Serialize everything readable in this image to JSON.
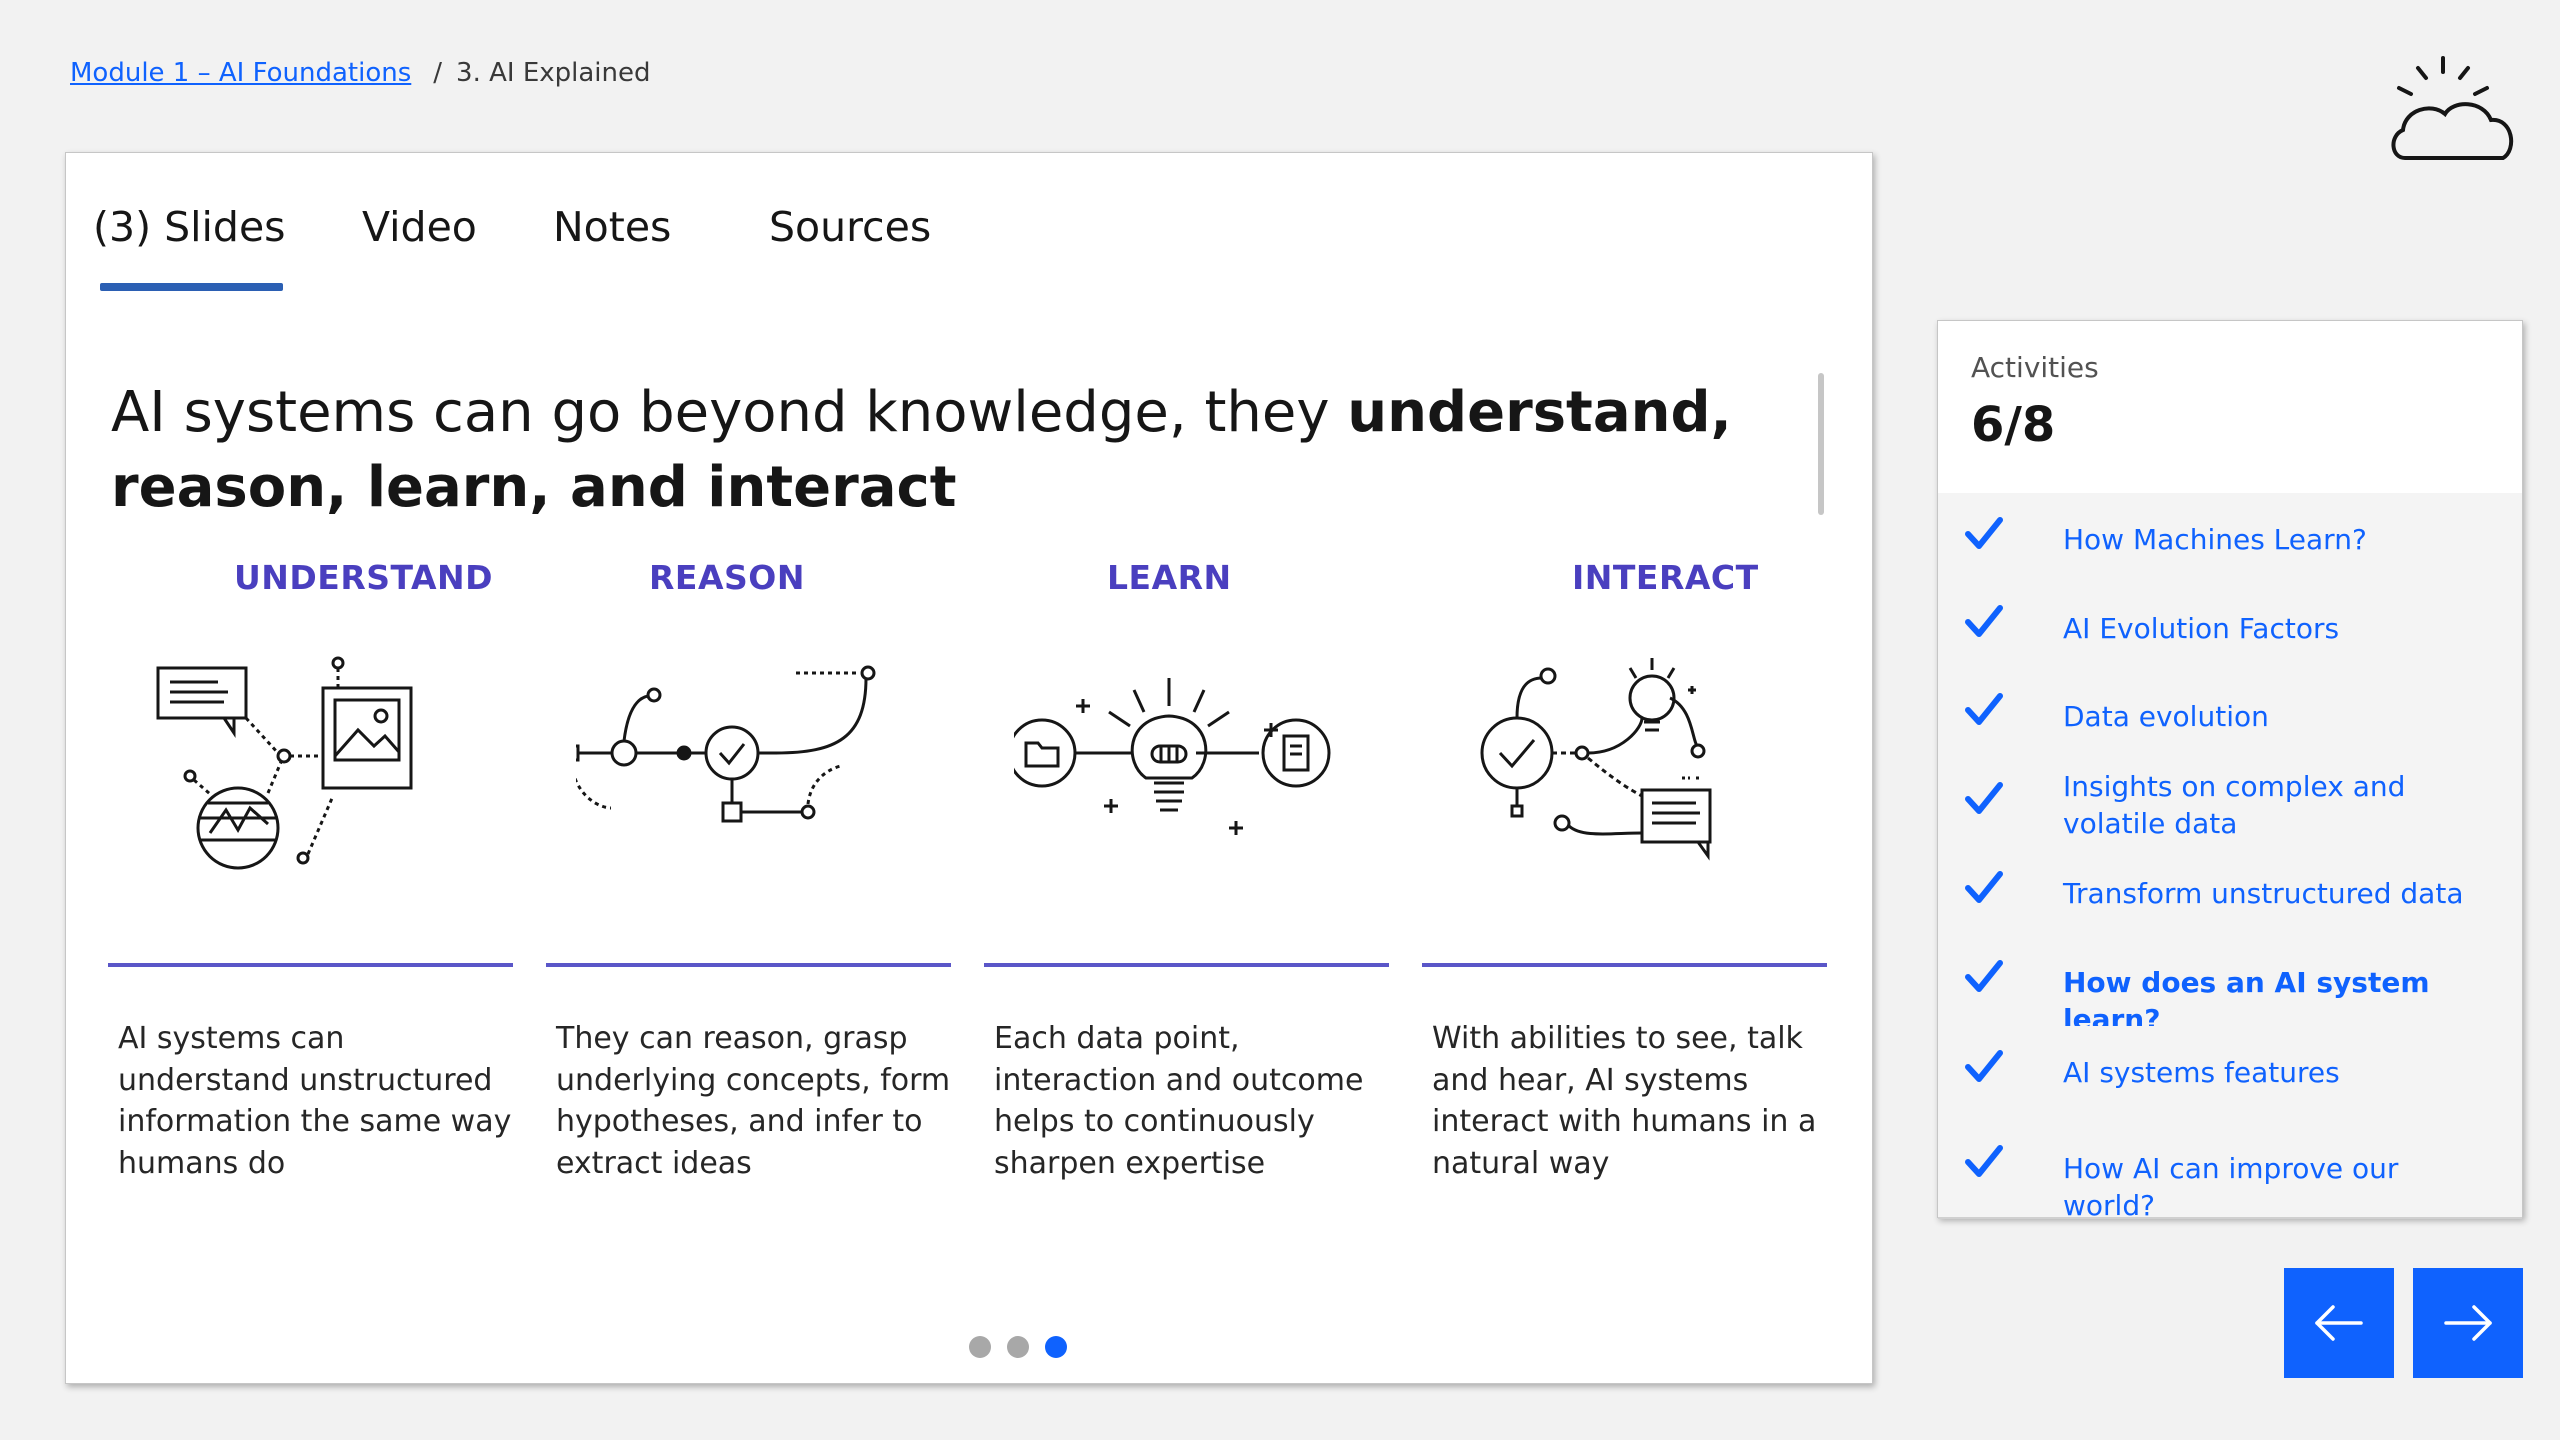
{
  "breadcrumb": {
    "module_link": "Module 1 – AI Foundations",
    "separator": "/",
    "current": "3. AI Explained"
  },
  "logo": {
    "icon": "sun-cloud-icon"
  },
  "tabs": [
    {
      "label": "(3) Slides",
      "selected": true
    },
    {
      "label": "Video",
      "selected": false
    },
    {
      "label": "Notes",
      "selected": false
    },
    {
      "label": "Sources",
      "selected": false
    }
  ],
  "slide": {
    "headline_plain": "AI systems can go beyond knowledge, they ",
    "headline_bold": "understand, reason, learn, and interact",
    "columns": [
      {
        "title": "UNDERSTAND",
        "icon": "understand-illustration-icon",
        "text": "AI systems can understand unstructured information the same way humans do"
      },
      {
        "title": "REASON",
        "icon": "reason-illustration-icon",
        "text": "They can reason, grasp underlying concepts, form hypotheses, and infer to extract ideas"
      },
      {
        "title": "LEARN",
        "icon": "learn-illustration-icon",
        "text": "Each data point, interaction and outcome helps to continuously sharpen expertise"
      },
      {
        "title": "INTERACT",
        "icon": "interact-illustration-icon",
        "text": "With abilities to see, talk and hear, AI systems interact with humans in a natural way"
      }
    ],
    "pagination": {
      "total": 3,
      "current": 3
    }
  },
  "activities": {
    "label": "Activities",
    "count": "6/8",
    "items": [
      {
        "label": "How Machines Learn?",
        "completed": true,
        "current": false
      },
      {
        "label": "AI Evolution Factors",
        "completed": true,
        "current": false
      },
      {
        "label": "Data evolution",
        "completed": true,
        "current": false
      },
      {
        "label": "Insights on complex and volatile data",
        "completed": true,
        "current": false
      },
      {
        "label": "Transform unstructured data",
        "completed": true,
        "current": false
      },
      {
        "label": "How does an AI system learn?",
        "completed": true,
        "current": true
      },
      {
        "label": "AI systems features",
        "completed": true,
        "current": false
      },
      {
        "label": "How AI can improve our world?",
        "completed": true,
        "current": false
      }
    ]
  },
  "nav": {
    "prev_icon": "arrow-left-icon",
    "next_icon": "arrow-right-icon"
  },
  "colors": {
    "accent": "#0f62fe",
    "column_title": "#4a3fbf",
    "tab_underline": "#2b5fb3"
  }
}
